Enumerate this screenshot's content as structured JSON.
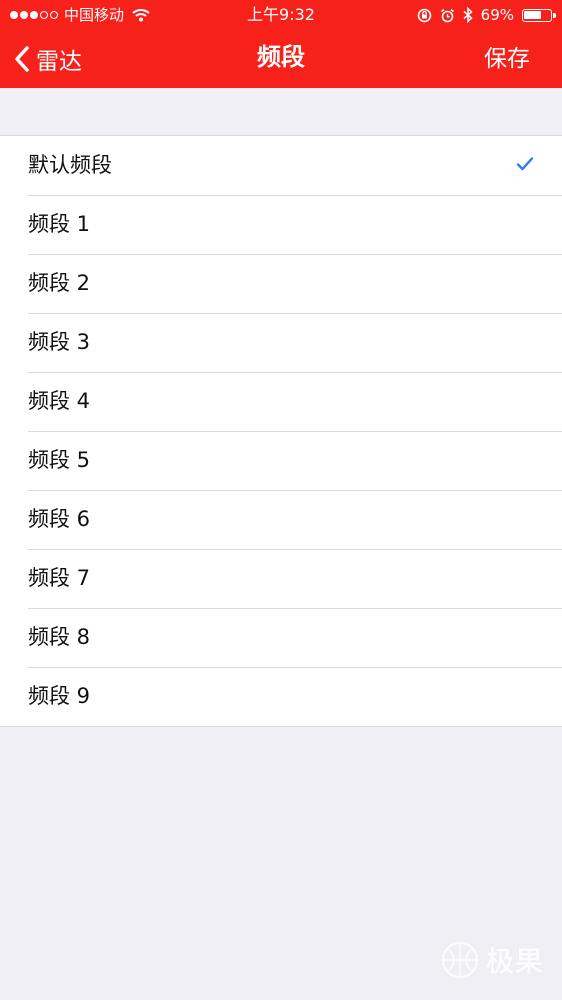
{
  "status_bar": {
    "carrier": "中国移动",
    "time": "上午9:32",
    "battery": "69%",
    "battery_level": 0.69
  },
  "nav": {
    "back_label": "雷达",
    "title": "频段",
    "save_label": "保存"
  },
  "bands": [
    {
      "label": "默认频段",
      "selected": true
    },
    {
      "label": "频段 1",
      "selected": false
    },
    {
      "label": "频段 2",
      "selected": false
    },
    {
      "label": "频段 3",
      "selected": false
    },
    {
      "label": "频段 4",
      "selected": false
    },
    {
      "label": "频段 5",
      "selected": false
    },
    {
      "label": "频段 6",
      "selected": false
    },
    {
      "label": "频段 7",
      "selected": false
    },
    {
      "label": "频段 8",
      "selected": false
    },
    {
      "label": "频段 9",
      "selected": false
    }
  ],
  "watermark": {
    "text": "极果"
  },
  "colors": {
    "accent": "#f5211a",
    "checkmark": "#2f7bf5",
    "background": "#efeff4"
  }
}
